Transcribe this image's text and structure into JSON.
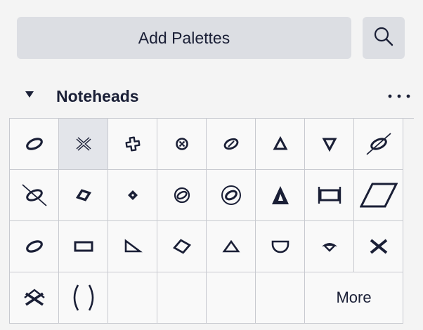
{
  "toolbar": {
    "add_palettes_label": "Add Palettes",
    "search_icon": "search-icon"
  },
  "palette": {
    "title": "Noteheads",
    "expanded": true,
    "more_label": "More",
    "selected_index": 1,
    "cells": [
      {
        "icon": "normal-notehead-icon"
      },
      {
        "icon": "cross-notehead-icon"
      },
      {
        "icon": "plus-notehead-icon"
      },
      {
        "icon": "circled-x-notehead-icon"
      },
      {
        "icon": "slashed-notehead-icon"
      },
      {
        "icon": "triangle-up-notehead-icon"
      },
      {
        "icon": "triangle-down-notehead-icon"
      },
      {
        "icon": "slash-forward-notehead-icon"
      },
      {
        "icon": "slash-backward-notehead-icon"
      },
      {
        "icon": "diamond-notehead-icon"
      },
      {
        "icon": "small-diamond-notehead-icon"
      },
      {
        "icon": "circled-notehead-icon"
      },
      {
        "icon": "large-circled-notehead-icon"
      },
      {
        "icon": "large-triangle-notehead-icon"
      },
      {
        "icon": "brevis-notehead-icon"
      },
      {
        "icon": "slash-notehead-icon"
      },
      {
        "icon": "alt-brevis-notehead-icon"
      },
      {
        "icon": "rectangle-notehead-icon"
      },
      {
        "icon": "right-triangle-notehead-icon"
      },
      {
        "icon": "hollow-diamond-notehead-icon"
      },
      {
        "icon": "small-triangle-notehead-icon"
      },
      {
        "icon": "half-circle-notehead-icon"
      },
      {
        "icon": "lens-notehead-icon"
      },
      {
        "icon": "bold-x-notehead-icon"
      },
      {
        "icon": "xcircle-notehead-icon"
      },
      {
        "icon": "parentheses-icon"
      }
    ]
  },
  "colors": {
    "background": "#f4f4f4",
    "button_bg": "#dcdee3",
    "cell_selected": "#e3e5ea",
    "glyph": "#1a1f36",
    "border": "#c8cad0"
  }
}
